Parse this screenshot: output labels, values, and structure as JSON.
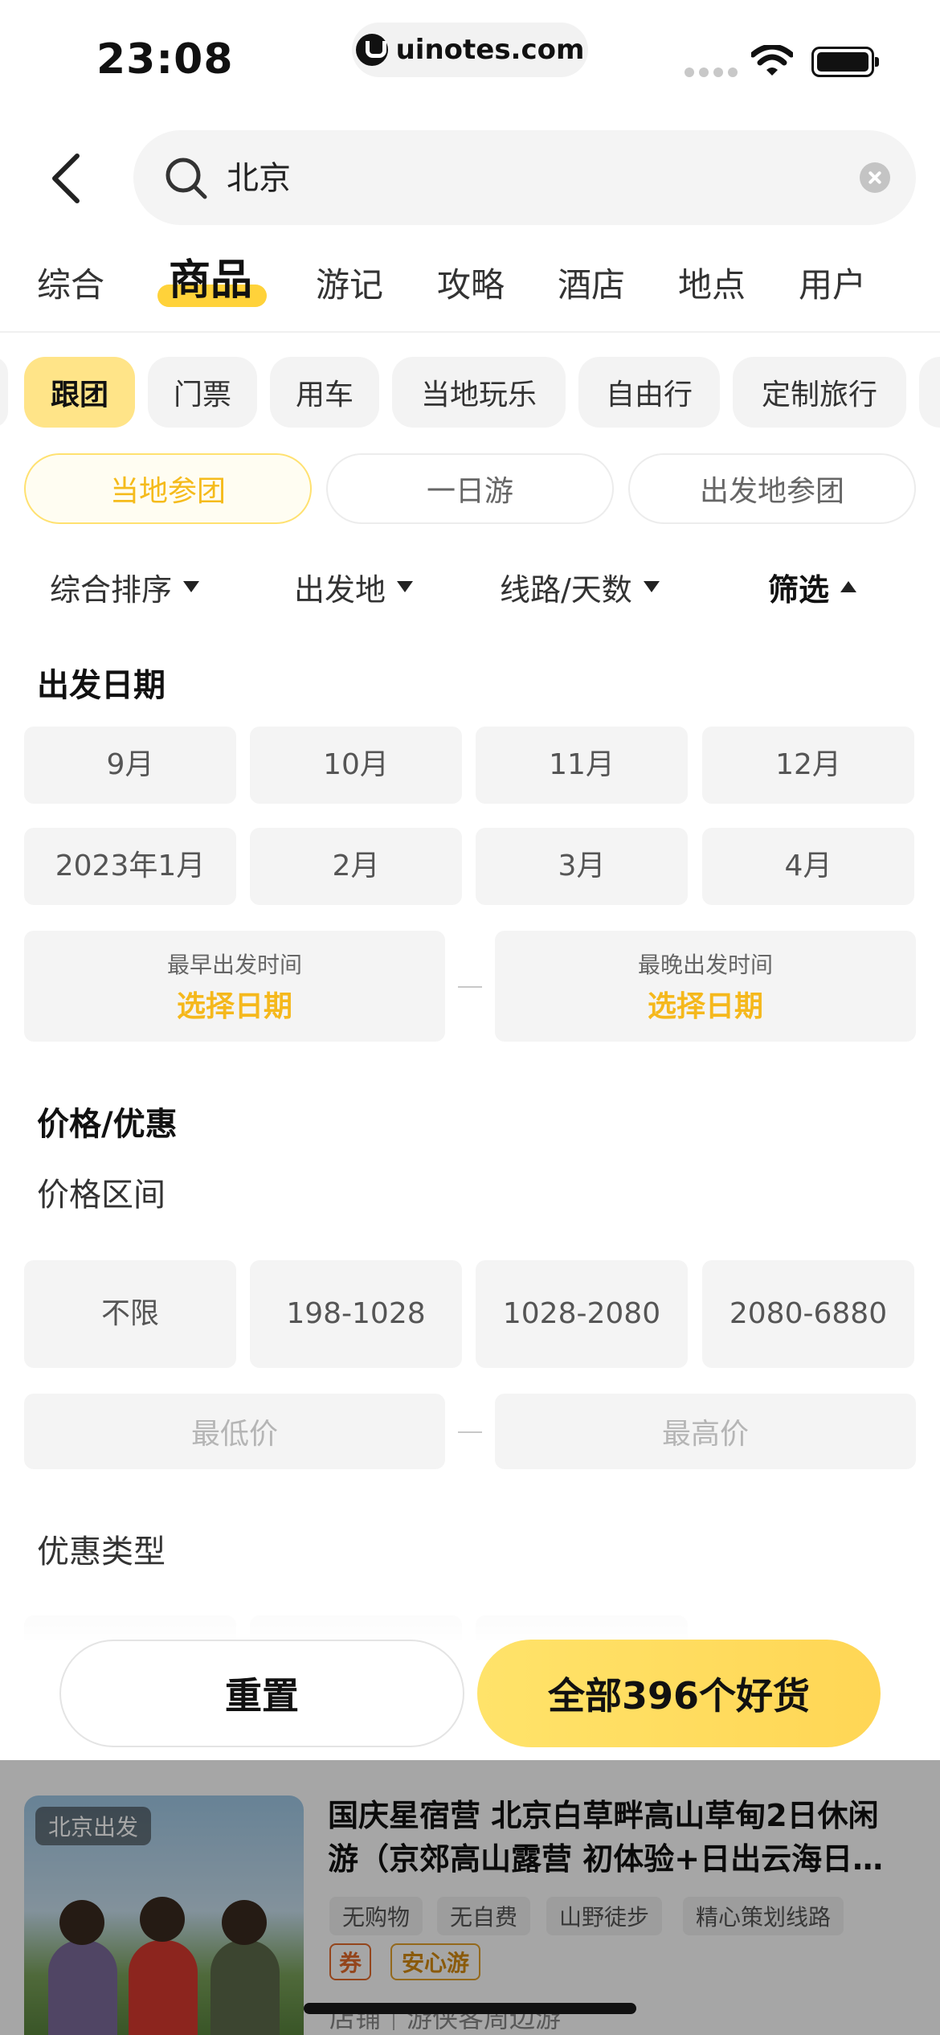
{
  "status_bar": {
    "time": "23:08",
    "url": "uinotes.com"
  },
  "search": {
    "query": "北京"
  },
  "main_tabs": [
    {
      "label": "综合"
    },
    {
      "label": "商品"
    },
    {
      "label": "游记"
    },
    {
      "label": "攻略"
    },
    {
      "label": "酒店"
    },
    {
      "label": "地点"
    },
    {
      "label": "用户"
    }
  ],
  "category_chips": [
    {
      "label": "跟团"
    },
    {
      "label": "门票"
    },
    {
      "label": "用车"
    },
    {
      "label": "当地玩乐"
    },
    {
      "label": "自由行"
    },
    {
      "label": "定制旅行"
    }
  ],
  "sub_tabs": [
    {
      "label": "当地参团"
    },
    {
      "label": "一日游"
    },
    {
      "label": "出发地参团"
    }
  ],
  "sort_bar": [
    {
      "label": "综合排序"
    },
    {
      "label": "出发地"
    },
    {
      "label": "线路/天数"
    },
    {
      "label": "筛选"
    }
  ],
  "filter": {
    "departure_date": {
      "title": "出发日期",
      "months": [
        "9月",
        "10月",
        "11月",
        "12月",
        "2023年1月",
        "2月",
        "3月",
        "4月"
      ],
      "earliest_label": "最早出发时间",
      "latest_label": "最晚出发时间",
      "pick_date": "选择日期"
    },
    "price": {
      "title": "价格/优惠",
      "range_label": "价格区间",
      "ranges": [
        "不限",
        "198-1028",
        "1028-2080",
        "2080-6880"
      ],
      "min_placeholder": "最低价",
      "max_placeholder": "最高价",
      "discount_label": "优惠类型"
    }
  },
  "actions": {
    "reset": "重置",
    "confirm": "全部396个好货"
  },
  "result_card": {
    "badge": "北京出发",
    "title": "国庆星宿营 北京白草畔高山草甸2日休闲游（京郊高山露营 初体验+日出云海日…",
    "tags": [
      "无购物",
      "无自费",
      "山野徒步",
      "精心策划线路"
    ],
    "coupon_tag": "券",
    "safe_tag": "安心游",
    "shop": "店铺｜游侠客周边游"
  },
  "colors": {
    "accent_yellow": "#ffd23a",
    "accent_text": "#f5b81c"
  }
}
